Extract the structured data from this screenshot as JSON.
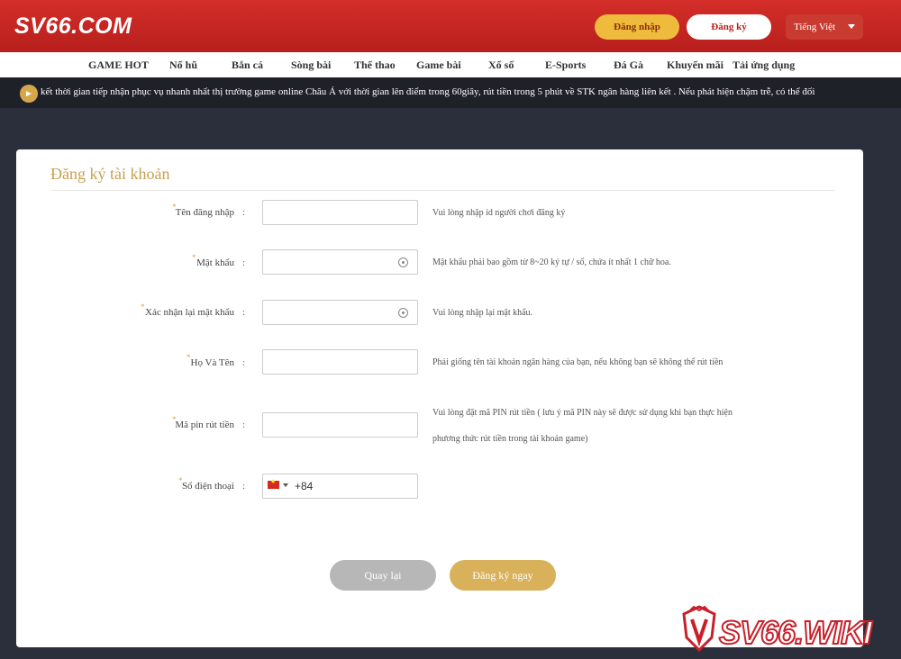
{
  "header": {
    "logo": "SV66.COM",
    "login_label": "Đăng nhập",
    "register_label": "Đăng ký",
    "language": "Tiếng Việt"
  },
  "nav": [
    "GAME HOT",
    "Nổ hũ",
    "Bắn cá",
    "Sòng bài",
    "Thể thao",
    "Game bài",
    "Xổ số",
    "E-Sports",
    "Đá Gà",
    "Khuyến mãi",
    "Tải ứng dụng"
  ],
  "marquee": {
    "text": "kết thời gian tiếp nhận phục vụ nhanh nhất thị trường game online Châu Á với thời gian lên điểm trong 60giây, rút tiền trong 5 phút về STK ngân hàng liên kết . Nếu phát hiện chậm trễ, có thể đối"
  },
  "form": {
    "title": "Đăng ký tài khoản",
    "fields": [
      {
        "label": "Tên đăng nhập",
        "value": "",
        "hint": "Vui lòng nhập id người chơi đăng ký"
      },
      {
        "label": "Mật khẩu",
        "value": "",
        "hint": "Mật khẩu phải bao gồm từ 8~20 ký tự / số, chứa ít nhất 1 chữ hoa."
      },
      {
        "label": "Xác nhận lại mật khẩu",
        "value": "",
        "hint": "Vui lòng nhập lại mật khẩu."
      },
      {
        "label": "Họ Và Tên",
        "value": "",
        "hint": "Phải giống tên tài khoản ngân hàng của bạn, nếu không bạn sẽ không thể rút tiền"
      },
      {
        "label": "Mã pin rút tiền",
        "value": "",
        "hint_line1": "Vui lòng đặt mã PIN rút tiền ( lưu ý mã PIN này sẽ được sử dụng khi bạn thực hiện",
        "hint_line2": "phương thức rút tiền trong tài khoản game)"
      },
      {
        "label": "Số điện thoại",
        "country_code": "+84"
      }
    ],
    "star": "*",
    "colon": ":",
    "back_label": "Quay lại",
    "submit_label": "Đăng ký ngay"
  },
  "watermark": "SV66.WIKI",
  "colors": {
    "header_red": "#c8231f",
    "gold": "#d9b15b",
    "dark_bg": "#2a2f3b"
  }
}
